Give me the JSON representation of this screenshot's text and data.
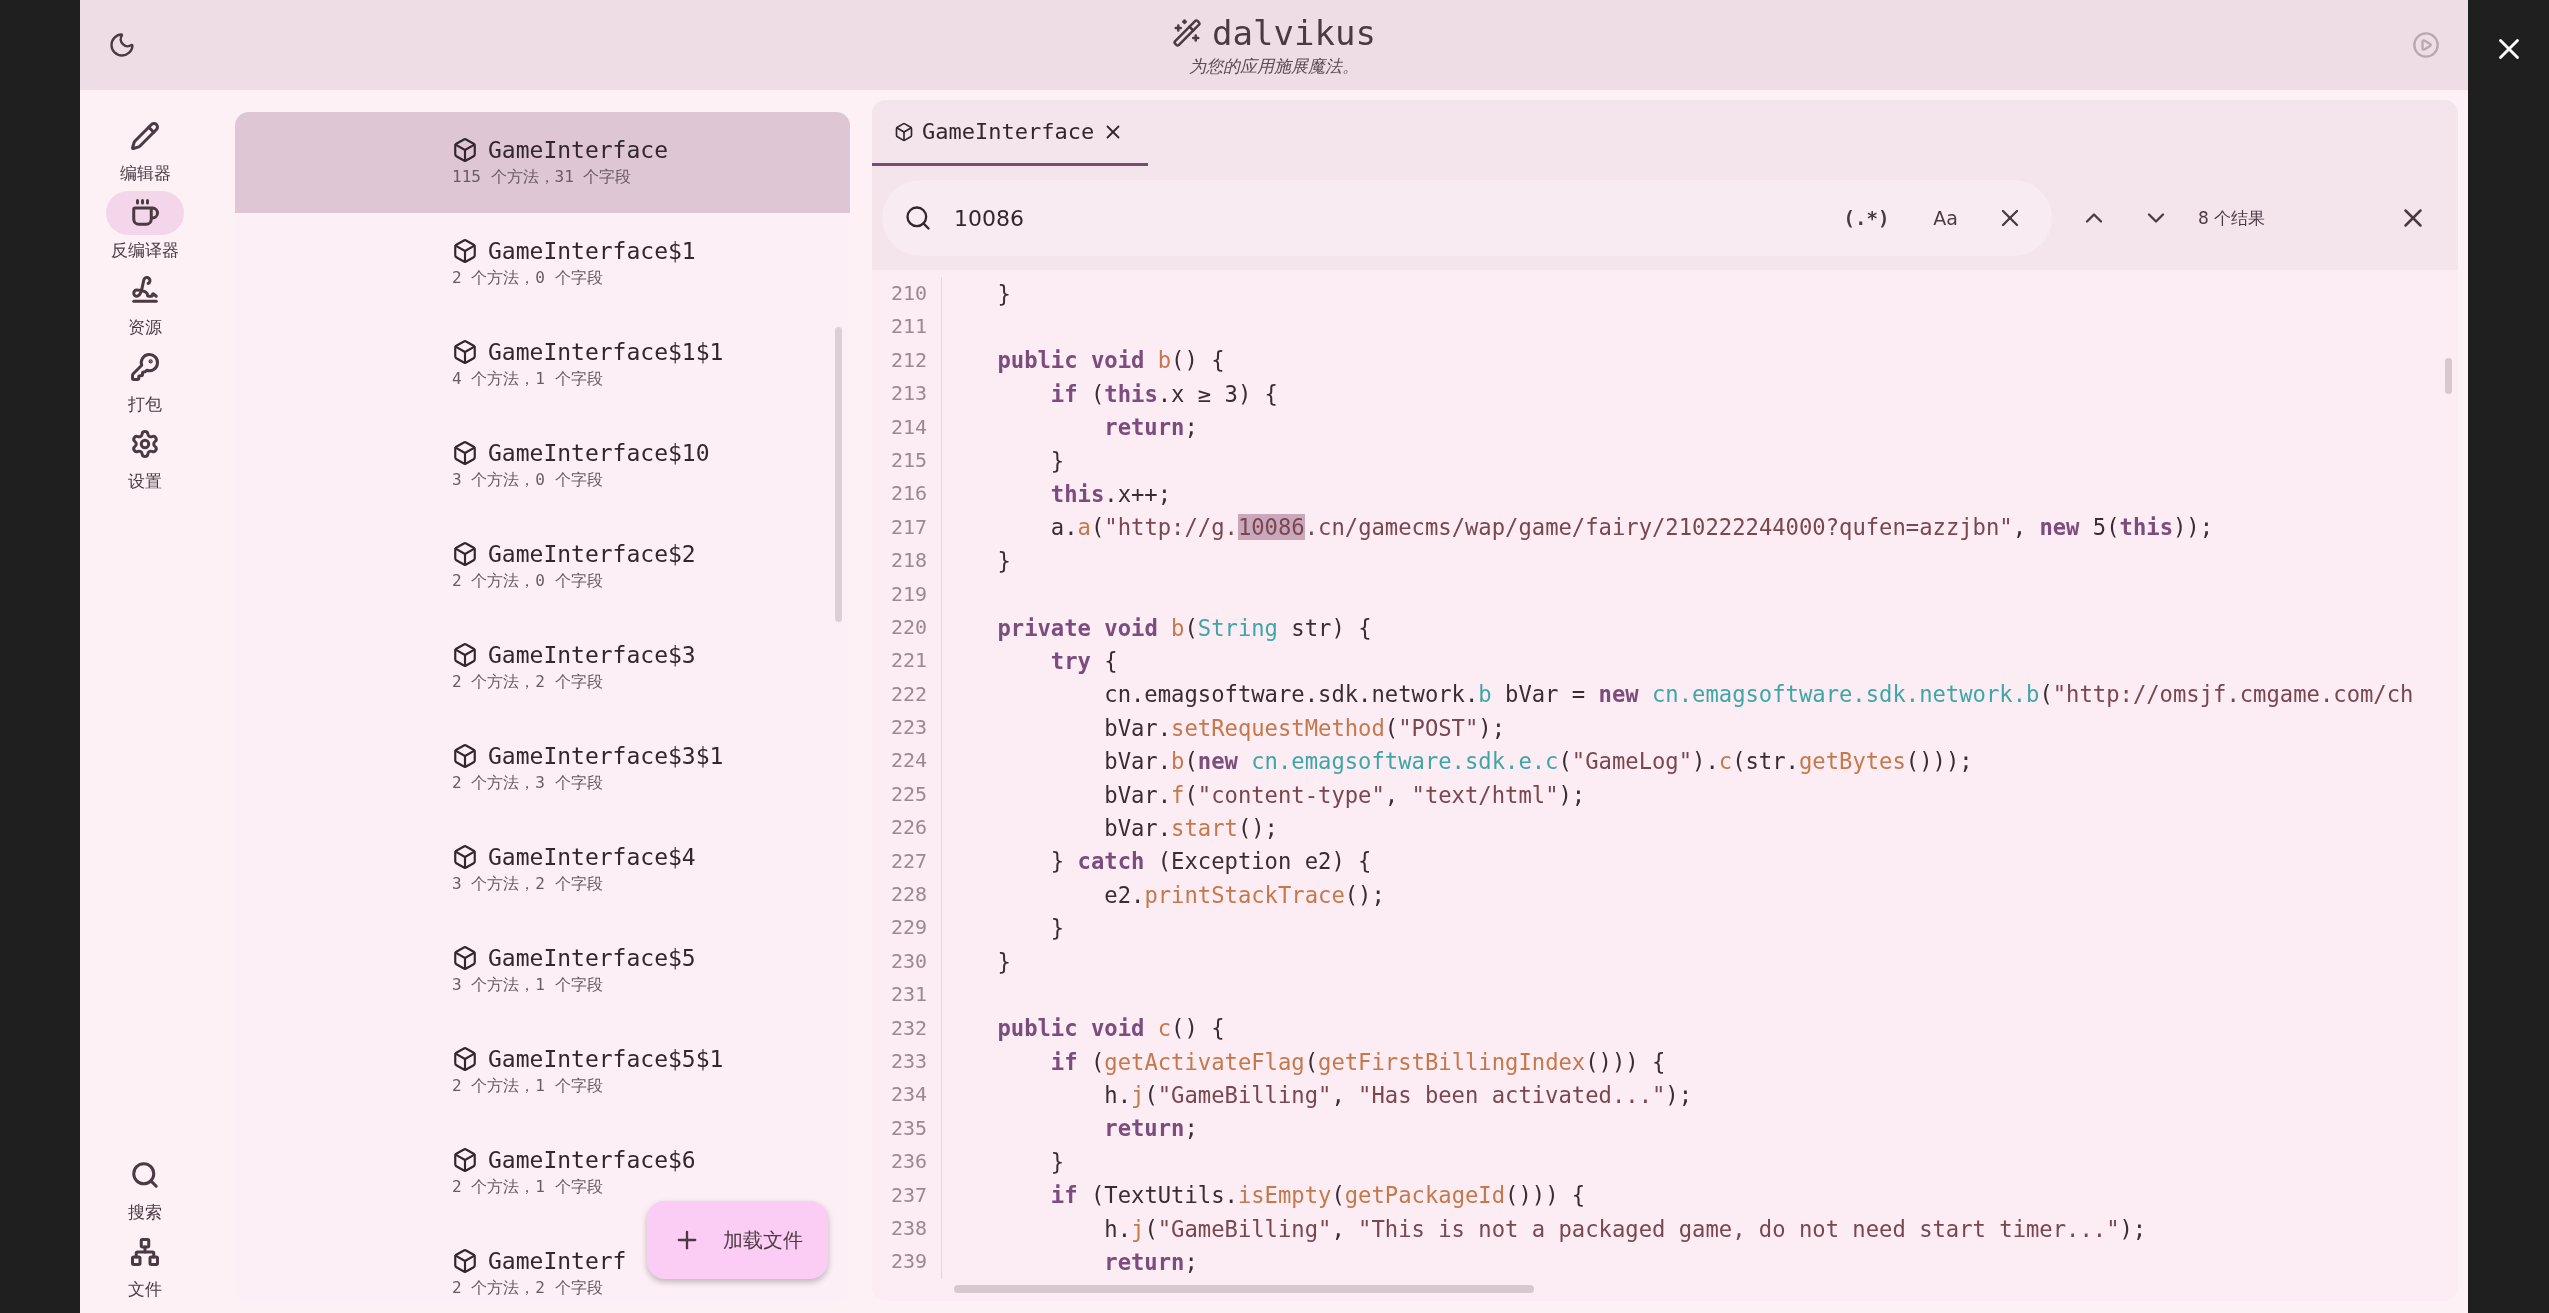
{
  "app": {
    "title": "dalvikus",
    "subtitle": "为您的应用施展魔法。"
  },
  "nav_top": [
    {
      "label": "编辑器",
      "selected": false
    },
    {
      "label": "反编译器",
      "selected": true
    },
    {
      "label": "资源",
      "selected": false
    },
    {
      "label": "打包",
      "selected": false
    },
    {
      "label": "设置",
      "selected": false
    }
  ],
  "nav_bottom": [
    {
      "label": "搜索",
      "selected": false
    },
    {
      "label": "文件",
      "selected": false
    }
  ],
  "classes": [
    {
      "name": "GameInterface",
      "info": "115 个方法，31 个字段",
      "selected": true
    },
    {
      "name": "GameInterface$1",
      "info": "2 个方法，0 个字段",
      "selected": false
    },
    {
      "name": "GameInterface$1$1",
      "info": "4 个方法，1 个字段",
      "selected": false
    },
    {
      "name": "GameInterface$10",
      "info": "3 个方法，0 个字段",
      "selected": false
    },
    {
      "name": "GameInterface$2",
      "info": "2 个方法，0 个字段",
      "selected": false
    },
    {
      "name": "GameInterface$3",
      "info": "2 个方法，2 个字段",
      "selected": false
    },
    {
      "name": "GameInterface$3$1",
      "info": "2 个方法，3 个字段",
      "selected": false
    },
    {
      "name": "GameInterface$4",
      "info": "3 个方法，2 个字段",
      "selected": false
    },
    {
      "name": "GameInterface$5",
      "info": "3 个方法，1 个字段",
      "selected": false
    },
    {
      "name": "GameInterface$5$1",
      "info": "2 个方法，1 个字段",
      "selected": false
    },
    {
      "name": "GameInterface$6",
      "info": "2 个方法，1 个字段",
      "selected": false
    },
    {
      "name": "GameInterf",
      "info": "2 个方法，2 个字段",
      "selected": false
    }
  ],
  "fab": {
    "label": "加载文件"
  },
  "tabs": [
    {
      "label": "GameInterface",
      "selected": true
    }
  ],
  "search": {
    "value": "10086",
    "regex_label": "(.*)",
    "case_label": "Aa",
    "result_count": "8 个结果"
  },
  "code": [
    {
      "n": "210",
      "tokens": [
        {
          "kind": "plain",
          "text": "    }"
        }
      ]
    },
    {
      "n": "211"
    },
    {
      "n": "212",
      "tokens": [
        {
          "kind": "keyword",
          "text": "    public"
        },
        {
          "kind": "keyword",
          "text": " void"
        },
        {
          "kind": "method",
          "text": " b"
        },
        {
          "kind": "plain",
          "text": "() {"
        }
      ]
    },
    {
      "n": "213",
      "tokens": [
        {
          "kind": "keyword",
          "text": "        if"
        },
        {
          "kind": "plain",
          "text": " ("
        },
        {
          "kind": "keyword",
          "text": "this"
        },
        {
          "kind": "plain",
          "text": ".x ≥ 3) {"
        }
      ]
    },
    {
      "n": "214",
      "tokens": [
        {
          "kind": "keyword",
          "text": "            return"
        },
        {
          "kind": "plain",
          "text": ";"
        }
      ]
    },
    {
      "n": "215",
      "tokens": [
        {
          "kind": "plain",
          "text": "        }"
        }
      ]
    },
    {
      "n": "216",
      "tokens": [
        {
          "kind": "keyword",
          "text": "        this"
        },
        {
          "kind": "plain",
          "text": ".x++;"
        }
      ]
    },
    {
      "n": "217",
      "tokens": [
        {
          "kind": "plain",
          "text": "        a."
        },
        {
          "kind": "method",
          "text": "a"
        },
        {
          "kind": "plain",
          "text": "("
        },
        {
          "kind": "string",
          "text": "\"http://g."
        },
        {
          "kind": "match",
          "text": "10086"
        },
        {
          "kind": "string",
          "text": ".cn/gamecms/wap/game/fairy/210222244000?qufen=azzjbn\""
        },
        {
          "kind": "plain",
          "text": ", "
        },
        {
          "kind": "keyword",
          "text": "new"
        },
        {
          "kind": "plain",
          "text": " 5("
        },
        {
          "kind": "keyword",
          "text": "this"
        },
        {
          "kind": "plain",
          "text": "));"
        }
      ]
    },
    {
      "n": "218",
      "tokens": [
        {
          "kind": "plain",
          "text": "    }"
        }
      ]
    },
    {
      "n": "219"
    },
    {
      "n": "220",
      "tokens": [
        {
          "kind": "keyword",
          "text": "    private"
        },
        {
          "kind": "keyword",
          "text": " void"
        },
        {
          "kind": "method",
          "text": " b"
        },
        {
          "kind": "plain",
          "text": "("
        },
        {
          "kind": "type",
          "text": "String"
        },
        {
          "kind": "plain",
          "text": " str) {"
        }
      ]
    },
    {
      "n": "221",
      "tokens": [
        {
          "kind": "keyword",
          "text": "        try"
        },
        {
          "kind": "plain",
          "text": " {"
        }
      ]
    },
    {
      "n": "222",
      "tokens": [
        {
          "kind": "plain",
          "text": "            cn.emagsoftware.sdk.network."
        },
        {
          "kind": "type",
          "text": "b"
        },
        {
          "kind": "plain",
          "text": " bVar = "
        },
        {
          "kind": "keyword",
          "text": "new"
        },
        {
          "kind": "type",
          "text": " cn.emagsoftware.sdk.network.b"
        },
        {
          "kind": "plain",
          "text": "("
        },
        {
          "kind": "string",
          "text": "\"http://omsjf.cmgame.com/ch"
        }
      ]
    },
    {
      "n": "223",
      "tokens": [
        {
          "kind": "plain",
          "text": "            bVar."
        },
        {
          "kind": "method",
          "text": "setRequestMethod"
        },
        {
          "kind": "plain",
          "text": "("
        },
        {
          "kind": "string",
          "text": "\"POST\""
        },
        {
          "kind": "plain",
          "text": ");"
        }
      ]
    },
    {
      "n": "224",
      "tokens": [
        {
          "kind": "plain",
          "text": "            bVar."
        },
        {
          "kind": "method",
          "text": "b"
        },
        {
          "kind": "plain",
          "text": "("
        },
        {
          "kind": "keyword",
          "text": "new"
        },
        {
          "kind": "type",
          "text": " cn.emagsoftware.sdk.e.c"
        },
        {
          "kind": "plain",
          "text": "("
        },
        {
          "kind": "string",
          "text": "\"GameLog\""
        },
        {
          "kind": "plain",
          "text": ")."
        },
        {
          "kind": "method",
          "text": "c"
        },
        {
          "kind": "plain",
          "text": "(str."
        },
        {
          "kind": "method",
          "text": "getBytes"
        },
        {
          "kind": "plain",
          "text": "()));"
        }
      ]
    },
    {
      "n": "225",
      "tokens": [
        {
          "kind": "plain",
          "text": "            bVar."
        },
        {
          "kind": "method",
          "text": "f"
        },
        {
          "kind": "plain",
          "text": "("
        },
        {
          "kind": "string",
          "text": "\"content-type\""
        },
        {
          "kind": "plain",
          "text": ", "
        },
        {
          "kind": "string",
          "text": "\"text/html\""
        },
        {
          "kind": "plain",
          "text": ");"
        }
      ]
    },
    {
      "n": "226",
      "tokens": [
        {
          "kind": "plain",
          "text": "            bVar."
        },
        {
          "kind": "method",
          "text": "start"
        },
        {
          "kind": "plain",
          "text": "();"
        }
      ]
    },
    {
      "n": "227",
      "tokens": [
        {
          "kind": "plain",
          "text": "        } "
        },
        {
          "kind": "keyword",
          "text": "catch"
        },
        {
          "kind": "plain",
          "text": " (Exception e2) {"
        }
      ]
    },
    {
      "n": "228",
      "tokens": [
        {
          "kind": "plain",
          "text": "            e2."
        },
        {
          "kind": "method",
          "text": "printStackTrace"
        },
        {
          "kind": "plain",
          "text": "();"
        }
      ]
    },
    {
      "n": "229",
      "tokens": [
        {
          "kind": "plain",
          "text": "        }"
        }
      ]
    },
    {
      "n": "230",
      "tokens": [
        {
          "kind": "plain",
          "text": "    }"
        }
      ]
    },
    {
      "n": "231"
    },
    {
      "n": "232",
      "tokens": [
        {
          "kind": "keyword",
          "text": "    public"
        },
        {
          "kind": "keyword",
          "text": " void"
        },
        {
          "kind": "method",
          "text": " c"
        },
        {
          "kind": "plain",
          "text": "() {"
        }
      ]
    },
    {
      "n": "233",
      "tokens": [
        {
          "kind": "keyword",
          "text": "        if"
        },
        {
          "kind": "plain",
          "text": " ("
        },
        {
          "kind": "method",
          "text": "getActivateFlag"
        },
        {
          "kind": "plain",
          "text": "("
        },
        {
          "kind": "method",
          "text": "getFirstBillingIndex"
        },
        {
          "kind": "plain",
          "text": "())) {"
        }
      ]
    },
    {
      "n": "234",
      "tokens": [
        {
          "kind": "plain",
          "text": "            h."
        },
        {
          "kind": "method",
          "text": "j"
        },
        {
          "kind": "plain",
          "text": "("
        },
        {
          "kind": "string",
          "text": "\"GameBilling\""
        },
        {
          "kind": "plain",
          "text": ", "
        },
        {
          "kind": "string",
          "text": "\"Has been activated...\""
        },
        {
          "kind": "plain",
          "text": ");"
        }
      ]
    },
    {
      "n": "235",
      "tokens": [
        {
          "kind": "keyword",
          "text": "            return"
        },
        {
          "kind": "plain",
          "text": ";"
        }
      ]
    },
    {
      "n": "236",
      "tokens": [
        {
          "kind": "plain",
          "text": "        }"
        }
      ]
    },
    {
      "n": "237",
      "tokens": [
        {
          "kind": "keyword",
          "text": "        if"
        },
        {
          "kind": "plain",
          "text": " (TextUtils."
        },
        {
          "kind": "method",
          "text": "isEmpty"
        },
        {
          "kind": "plain",
          "text": "("
        },
        {
          "kind": "method",
          "text": "getPackageId"
        },
        {
          "kind": "plain",
          "text": "())) {"
        }
      ]
    },
    {
      "n": "238",
      "tokens": [
        {
          "kind": "plain",
          "text": "            h."
        },
        {
          "kind": "method",
          "text": "j"
        },
        {
          "kind": "plain",
          "text": "("
        },
        {
          "kind": "string",
          "text": "\"GameBilling\""
        },
        {
          "kind": "plain",
          "text": ", "
        },
        {
          "kind": "string",
          "text": "\"This is not a packaged game, do not need start timer...\""
        },
        {
          "kind": "plain",
          "text": ");"
        }
      ]
    },
    {
      "n": "239",
      "tokens": [
        {
          "kind": "keyword",
          "text": "            return"
        },
        {
          "kind": "plain",
          "text": ";"
        }
      ]
    }
  ]
}
